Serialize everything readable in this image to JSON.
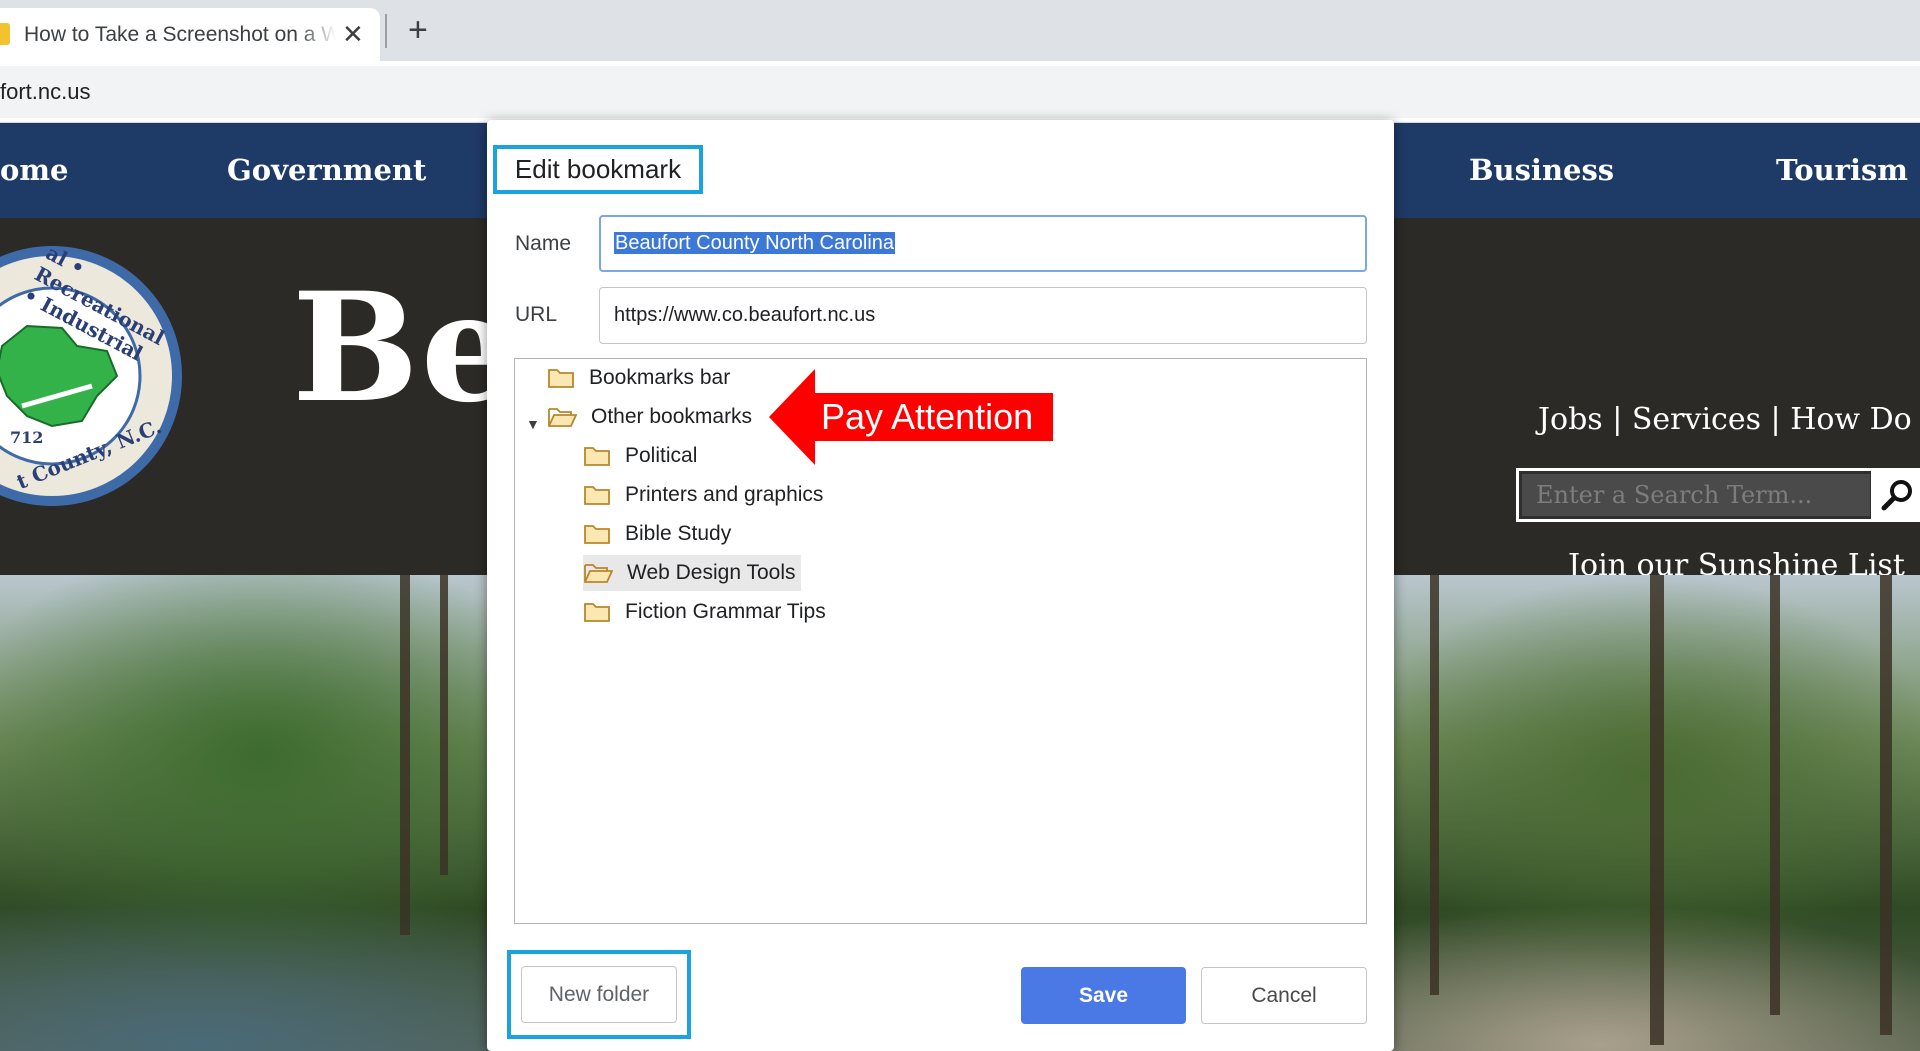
{
  "browser": {
    "tab_title": "How to Take a Screenshot on a Windows",
    "tab_close_glyph": "✕",
    "new_tab_glyph": "+",
    "address": "fort.nc.us"
  },
  "site": {
    "nav": [
      "ome",
      "Government",
      "Business",
      "Tourism"
    ],
    "seal": {
      "arc_top": "al • Recreational • Industrial",
      "arc_bottom": "t County, N.C.",
      "year": "712"
    },
    "title_fragment": "Bea",
    "header_links": "Jobs | Services | How Do I?",
    "search_placeholder": "Enter a Search Term...",
    "sunshine": "Join our Sunshine List"
  },
  "dialog": {
    "title": "Edit bookmark",
    "name_label": "Name",
    "name_value": "Beaufort County North Carolina",
    "url_label": "URL",
    "url_value": "https://www.co.beaufort.nc.us",
    "tree": [
      {
        "label": "Bookmarks bar",
        "level": 0,
        "open": false
      },
      {
        "label": "Other bookmarks",
        "level": 0,
        "open": true
      },
      {
        "label": "Political",
        "level": 1,
        "open": false
      },
      {
        "label": "Printers and graphics",
        "level": 1,
        "open": false
      },
      {
        "label": "Bible Study",
        "level": 1,
        "open": false
      },
      {
        "label": "Web Design Tools",
        "level": 1,
        "open": true
      },
      {
        "label": "Fiction Grammar Tips",
        "level": 1,
        "open": false
      }
    ],
    "annotation": "Pay Attention",
    "new_folder": "New folder",
    "save": "Save",
    "cancel": "Cancel"
  },
  "colors": {
    "nav_bg": "#1e3a66",
    "header_bg": "#2b2a27",
    "highlight_box": "#1aa3e0",
    "save_button": "#4a79e6",
    "annotation": "#ff0000",
    "selection": "#3c78d8"
  }
}
